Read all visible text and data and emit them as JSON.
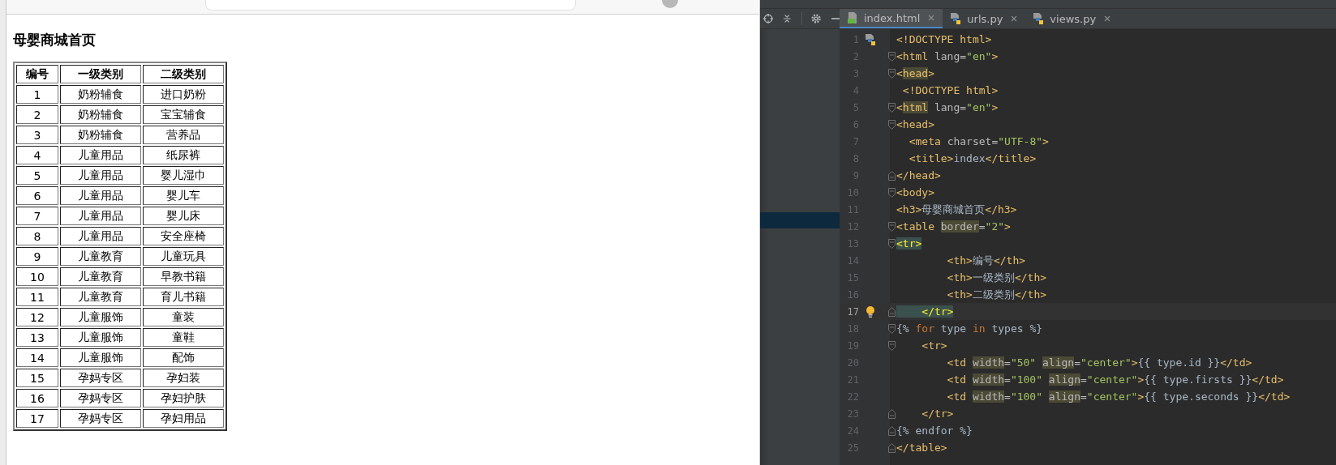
{
  "browser": {
    "page": {
      "heading": "母婴商城首页",
      "table": {
        "columns": [
          "编号",
          "一级类别",
          "二级类别"
        ],
        "rows": [
          [
            "1",
            "奶粉辅食",
            "进口奶粉"
          ],
          [
            "2",
            "奶粉辅食",
            "宝宝辅食"
          ],
          [
            "3",
            "奶粉辅食",
            "营养品"
          ],
          [
            "4",
            "儿童用品",
            "纸尿裤"
          ],
          [
            "5",
            "儿童用品",
            "婴儿湿巾"
          ],
          [
            "6",
            "儿童用品",
            "婴儿车"
          ],
          [
            "7",
            "儿童用品",
            "婴儿床"
          ],
          [
            "8",
            "儿童用品",
            "安全座椅"
          ],
          [
            "9",
            "儿童教育",
            "儿童玩具"
          ],
          [
            "10",
            "儿童教育",
            "早教书籍"
          ],
          [
            "11",
            "儿童教育",
            "育儿书籍"
          ],
          [
            "12",
            "儿童服饰",
            "童装"
          ],
          [
            "13",
            "儿童服饰",
            "童鞋"
          ],
          [
            "14",
            "儿童服饰",
            "配饰"
          ],
          [
            "15",
            "孕妈专区",
            "孕妇装"
          ],
          [
            "16",
            "孕妈专区",
            "孕妇护肤"
          ],
          [
            "17",
            "孕妈专区",
            "孕妇用品"
          ]
        ]
      }
    }
  },
  "ide": {
    "tabs": [
      {
        "label": "index.html",
        "kind": "html",
        "selected": true
      },
      {
        "label": "urls.py",
        "kind": "python",
        "selected": false
      },
      {
        "label": "views.py",
        "kind": "python",
        "selected": false
      }
    ],
    "editor": {
      "lines": [
        {
          "number": "1",
          "current": false,
          "gutter": [
            {
              "kind": "python"
            }
          ],
          "tokens": [
            {
              "kind": "tag",
              "text": "<!DOCTYPE html>"
            }
          ]
        },
        {
          "number": "2",
          "current": false,
          "gutter": [
            {
              "kind": "fold-start"
            }
          ],
          "tokens": [
            {
              "kind": "tag",
              "text": "<html "
            },
            {
              "kind": "attr",
              "text": "lang="
            },
            {
              "kind": "value",
              "text": "\"en\""
            },
            {
              "kind": "tag",
              "text": ">"
            }
          ]
        },
        {
          "number": "3",
          "current": false,
          "gutter": [
            {
              "kind": "fold-start"
            }
          ],
          "tokens": [
            {
              "kind": "tag",
              "text": "<"
            },
            {
              "kind": "tag-hl",
              "text": "head"
            },
            {
              "kind": "tag",
              "text": ">"
            }
          ]
        },
        {
          "number": "4",
          "current": false,
          "tokens": [
            {
              "kind": "tag",
              "text": " <!DOCTYPE html>"
            }
          ]
        },
        {
          "number": "5",
          "current": false,
          "gutter": [
            {
              "kind": "fold-start"
            }
          ],
          "tokens": [
            {
              "kind": "tag",
              "text": "<"
            },
            {
              "kind": "tag-hl",
              "text": "html"
            },
            {
              "kind": "attr",
              "text": " lang="
            },
            {
              "kind": "value",
              "text": "\"en\""
            },
            {
              "kind": "tag",
              "text": ">"
            }
          ]
        },
        {
          "number": "6",
          "current": false,
          "gutter": [
            {
              "kind": "fold-start"
            }
          ],
          "tokens": [
            {
              "kind": "tag",
              "text": "<head>"
            }
          ]
        },
        {
          "number": "7",
          "current": false,
          "tokens": [
            {
              "kind": "tag",
              "text": "  <meta "
            },
            {
              "kind": "attr",
              "text": "charset="
            },
            {
              "kind": "value",
              "text": "\"UTF-8\""
            },
            {
              "kind": "tag",
              "text": ">"
            }
          ]
        },
        {
          "number": "8",
          "current": false,
          "tokens": [
            {
              "kind": "tag",
              "text": "  <title>"
            },
            {
              "kind": "text",
              "text": "index"
            },
            {
              "kind": "tag",
              "text": "</title>"
            }
          ]
        },
        {
          "number": "9",
          "current": false,
          "gutter": [
            {
              "kind": "fold-end"
            }
          ],
          "tokens": [
            {
              "kind": "tag",
              "text": "</head>"
            }
          ]
        },
        {
          "number": "10",
          "current": false,
          "gutter": [
            {
              "kind": "fold-start"
            }
          ],
          "tokens": [
            {
              "kind": "tag",
              "text": "<body>"
            }
          ]
        },
        {
          "number": "11",
          "current": false,
          "tokens": [
            {
              "kind": "tag",
              "text": "<h3>"
            },
            {
              "kind": "text",
              "text": "母婴商城首页"
            },
            {
              "kind": "tag",
              "text": "</h3>"
            }
          ]
        },
        {
          "number": "12",
          "current": false,
          "gutter": [
            {
              "kind": "fold-start"
            }
          ],
          "tokens": [
            {
              "kind": "tag",
              "text": "<table "
            },
            {
              "kind": "attr-hl",
              "text": "border"
            },
            {
              "kind": "attr",
              "text": "="
            },
            {
              "kind": "value",
              "text": "\"2\""
            },
            {
              "kind": "tag",
              "text": ">"
            }
          ]
        },
        {
          "number": "13",
          "current": false,
          "gutter": [
            {
              "kind": "fold-start"
            }
          ],
          "tokens": [
            {
              "kind": "match",
              "text": "<tr>"
            }
          ]
        },
        {
          "number": "14",
          "current": false,
          "tokens": [
            {
              "kind": "tag",
              "text": "        <th>"
            },
            {
              "kind": "text",
              "text": "编号"
            },
            {
              "kind": "tag",
              "text": "</th>"
            }
          ]
        },
        {
          "number": "15",
          "current": false,
          "tokens": [
            {
              "kind": "tag",
              "text": "        <th>"
            },
            {
              "kind": "text",
              "text": "一级类别"
            },
            {
              "kind": "tag",
              "text": "</th>"
            }
          ]
        },
        {
          "number": "16",
          "current": false,
          "tokens": [
            {
              "kind": "tag",
              "text": "        <th>"
            },
            {
              "kind": "text",
              "text": "二级类别"
            },
            {
              "kind": "tag",
              "text": "</th>"
            }
          ]
        },
        {
          "number": "17",
          "current": true,
          "gutter": [
            {
              "kind": "bulb"
            },
            {
              "kind": "fold-end"
            }
          ],
          "tokens": [
            {
              "kind": "match",
              "text": "    </tr>"
            }
          ]
        },
        {
          "number": "18",
          "current": false,
          "gutter": [
            {
              "kind": "fold-start"
            }
          ],
          "tokens": [
            {
              "kind": "text",
              "text": "{% "
            },
            {
              "kind": "keyword",
              "text": "for"
            },
            {
              "kind": "text",
              "text": " type "
            },
            {
              "kind": "keyword",
              "text": "in"
            },
            {
              "kind": "text",
              "text": " types %}"
            }
          ]
        },
        {
          "number": "19",
          "current": false,
          "gutter": [
            {
              "kind": "fold-start"
            }
          ],
          "tokens": [
            {
              "kind": "tag",
              "text": "    <tr>"
            }
          ]
        },
        {
          "number": "20",
          "current": false,
          "tokens": [
            {
              "kind": "tag",
              "text": "        <td "
            },
            {
              "kind": "attr-hl",
              "text": "width"
            },
            {
              "kind": "attr",
              "text": "="
            },
            {
              "kind": "value",
              "text": "\"50\" "
            },
            {
              "kind": "attr-hl",
              "text": "align"
            },
            {
              "kind": "attr",
              "text": "="
            },
            {
              "kind": "value",
              "text": "\"center\""
            },
            {
              "kind": "tag",
              "text": ">"
            },
            {
              "kind": "text",
              "text": "{{ type.id }}"
            },
            {
              "kind": "tag",
              "text": "</td>"
            }
          ]
        },
        {
          "number": "21",
          "current": false,
          "tokens": [
            {
              "kind": "tag",
              "text": "        <td "
            },
            {
              "kind": "attr-hl",
              "text": "width"
            },
            {
              "kind": "attr",
              "text": "="
            },
            {
              "kind": "value",
              "text": "\"100\" "
            },
            {
              "kind": "attr-hl",
              "text": "align"
            },
            {
              "kind": "attr",
              "text": "="
            },
            {
              "kind": "value",
              "text": "\"center\""
            },
            {
              "kind": "tag",
              "text": ">"
            },
            {
              "kind": "text",
              "text": "{{ type.firsts }}"
            },
            {
              "kind": "tag",
              "text": "</td>"
            }
          ]
        },
        {
          "number": "22",
          "current": false,
          "tokens": [
            {
              "kind": "tag",
              "text": "        <td "
            },
            {
              "kind": "attr-hl",
              "text": "width"
            },
            {
              "kind": "attr",
              "text": "="
            },
            {
              "kind": "value",
              "text": "\"100\" "
            },
            {
              "kind": "attr-hl",
              "text": "align"
            },
            {
              "kind": "attr",
              "text": "="
            },
            {
              "kind": "value",
              "text": "\"center\""
            },
            {
              "kind": "tag",
              "text": ">"
            },
            {
              "kind": "text",
              "text": "{{ type.seconds }}"
            },
            {
              "kind": "tag",
              "text": "</td>"
            }
          ]
        },
        {
          "number": "23",
          "current": false,
          "gutter": [
            {
              "kind": "fold-end"
            }
          ],
          "tokens": [
            {
              "kind": "tag",
              "text": "    </tr>"
            }
          ]
        },
        {
          "number": "24",
          "current": false,
          "gutter": [
            {
              "kind": "fold-end"
            }
          ],
          "tokens": [
            {
              "kind": "text",
              "text": "{% endfor %}"
            }
          ]
        },
        {
          "number": "25",
          "current": false,
          "gutter": [
            {
              "kind": "fold-end"
            }
          ],
          "tokens": [
            {
              "kind": "tag",
              "text": "</table>"
            }
          ]
        }
      ]
    }
  }
}
